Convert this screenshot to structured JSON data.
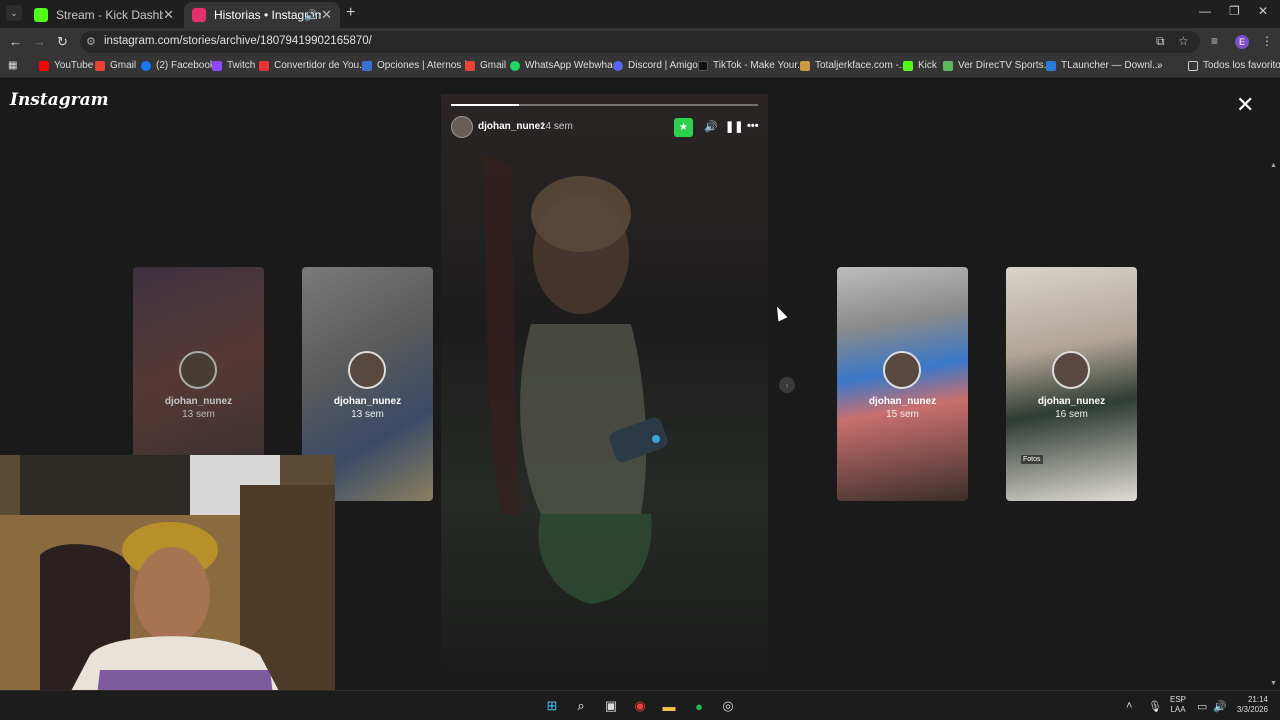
{
  "browser": {
    "tabs": [
      {
        "title": "Stream - Kick Dashboard",
        "favicon_color": "#53fc18",
        "active": false
      },
      {
        "title": "Historias • Instagram",
        "favicon_color": "#e1306c",
        "active": true
      }
    ],
    "url": "instagram.com/stories/archive/18079419902165870/",
    "profile_initial": "E",
    "bookmarks": [
      {
        "label": "YouTube",
        "icon": "youtube-icon",
        "color": "#ff0000"
      },
      {
        "label": "Gmail",
        "icon": "gmail-icon",
        "color": "#ea4335"
      },
      {
        "label": "(2) Facebook",
        "icon": "facebook-icon",
        "color": "#1877f2"
      },
      {
        "label": "Twitch",
        "icon": "twitch-icon",
        "color": "#9146ff"
      },
      {
        "label": "Convertidor de You...",
        "icon": "converter-icon",
        "color": "#e33"
      },
      {
        "label": "Opciones | Aternos |...",
        "icon": "aternos-icon",
        "color": "#3b6fd1"
      },
      {
        "label": "Gmail",
        "icon": "gmail-icon",
        "color": "#ea4335"
      },
      {
        "label": "WhatsApp Webwha...",
        "icon": "whatsapp-icon",
        "color": "#25d366"
      },
      {
        "label": "Discord | Amigos",
        "icon": "discord-icon",
        "color": "#5865f2"
      },
      {
        "label": "TikTok - Make Your...",
        "icon": "tiktok-icon",
        "color": "#111111"
      },
      {
        "label": "Totaljerkface.com -...",
        "icon": "totaljerkface-icon",
        "color": "#c94"
      },
      {
        "label": "Kick",
        "icon": "kick-icon",
        "color": "#53fc18"
      },
      {
        "label": "Ver DirecTV Sports...",
        "icon": "directv-icon",
        "color": "#5fb85f"
      },
      {
        "label": "TLauncher — Downl...",
        "icon": "tlauncher-icon",
        "color": "#2a7bd8"
      }
    ],
    "all_bookmarks_label": "Todos los favoritos"
  },
  "instagram": {
    "logo": "Instagram",
    "main_story": {
      "username": "djohan_nunez",
      "age": "14 sem",
      "progress": 0.22
    },
    "side_stories": [
      {
        "username": "djohan_nunez",
        "age": "13 sem",
        "tag": ""
      },
      {
        "username": "djohan_nunez",
        "age": "13 sem",
        "tag": ""
      },
      {
        "username": "djohan_nunez",
        "age": "15 sem",
        "tag": ""
      },
      {
        "username": "djohan_nunez",
        "age": "16 sem",
        "tag": "Fotos"
      }
    ]
  },
  "taskbar": {
    "language": "ESP",
    "layout": "LAA",
    "time": "21:14",
    "date": "3/3/2026"
  }
}
